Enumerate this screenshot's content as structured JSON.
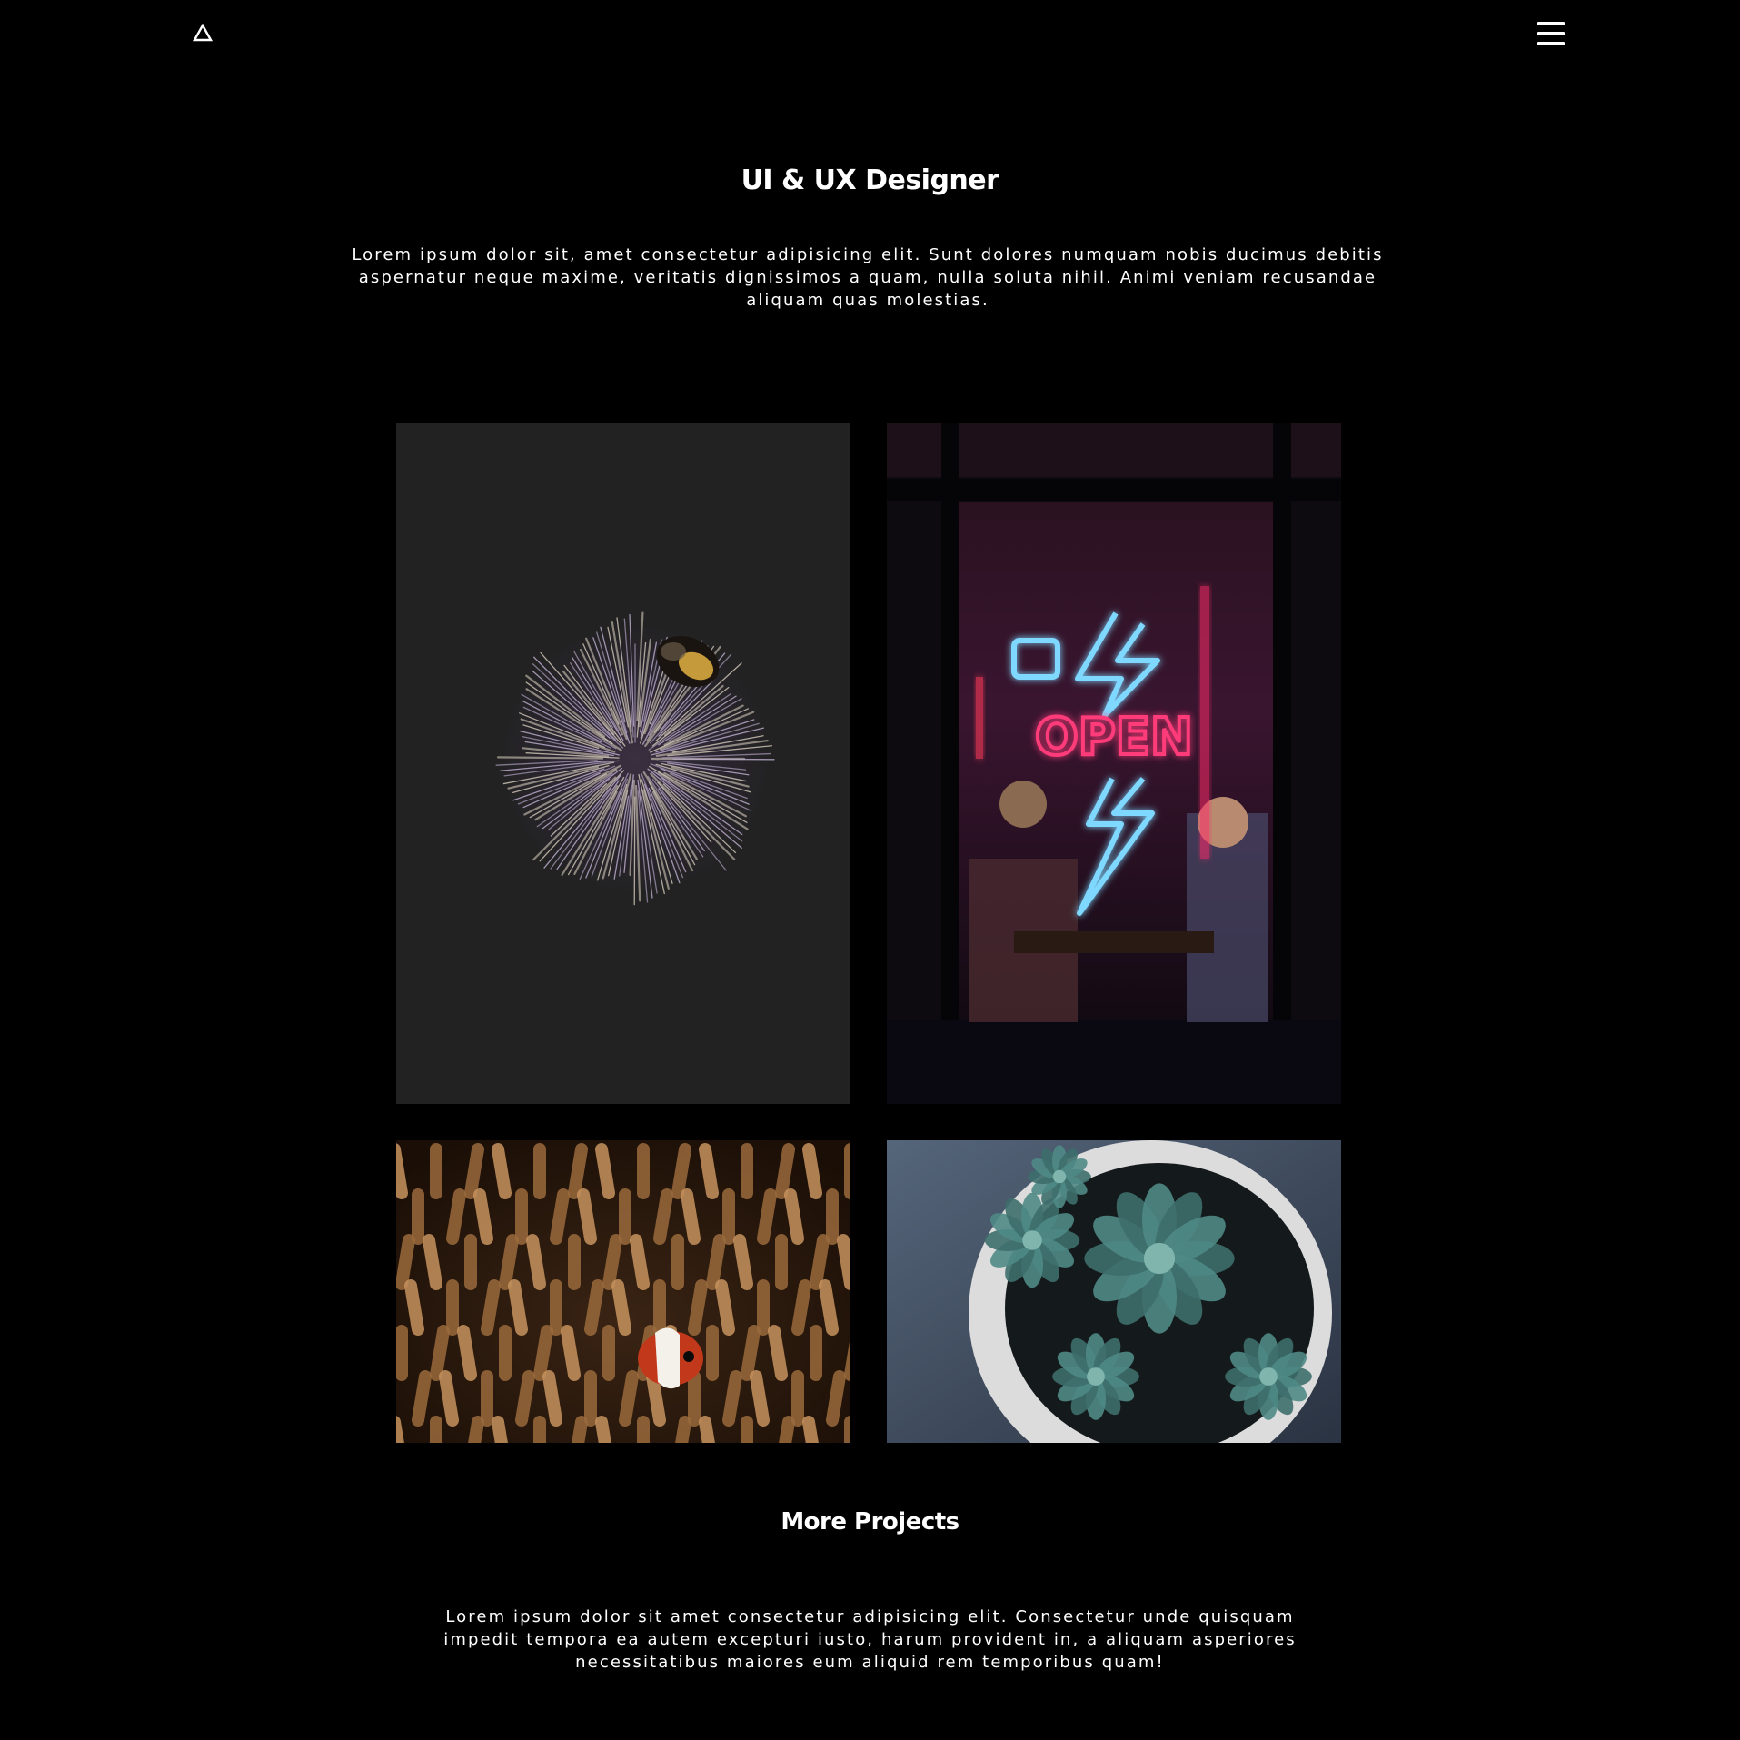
{
  "header": {
    "logo_icon": "triangle-logo-icon",
    "menu_icon": "hamburger-menu-icon"
  },
  "hero": {
    "title": "UI & UX Designer",
    "description": "Lorem ipsum dolor sit, amet consectetur adipisicing elit. Sunt dolores numquam nobis ducimus debitis aspernatur neque maxime, veritatis dignissimos a quam, nulla soluta nihil. Animi veniam recusandae aliquam quas molestias."
  },
  "gallery": {
    "items": [
      {
        "name": "bee-on-flower-image",
        "sign_text": ""
      },
      {
        "name": "neon-open-sign-image",
        "sign_text": "OPEN"
      },
      {
        "name": "clownfish-anemone-image",
        "sign_text": ""
      },
      {
        "name": "succulent-pot-image",
        "sign_text": ""
      }
    ]
  },
  "more_projects": {
    "title": "More Projects",
    "description": "Lorem ipsum dolor sit amet consectetur adipisicing elit. Consectetur unde quisquam impedit tempora ea autem excepturi iusto, harum provident in, a aliquam asperiores necessitatibus maiores eum aliquid rem temporibus quam!"
  },
  "colors": {
    "background": "#000000",
    "text": "#ffffff",
    "tile_dark": "#222222",
    "neon_pink": "#ff3b7a",
    "neon_blue": "#7fd8ff"
  }
}
